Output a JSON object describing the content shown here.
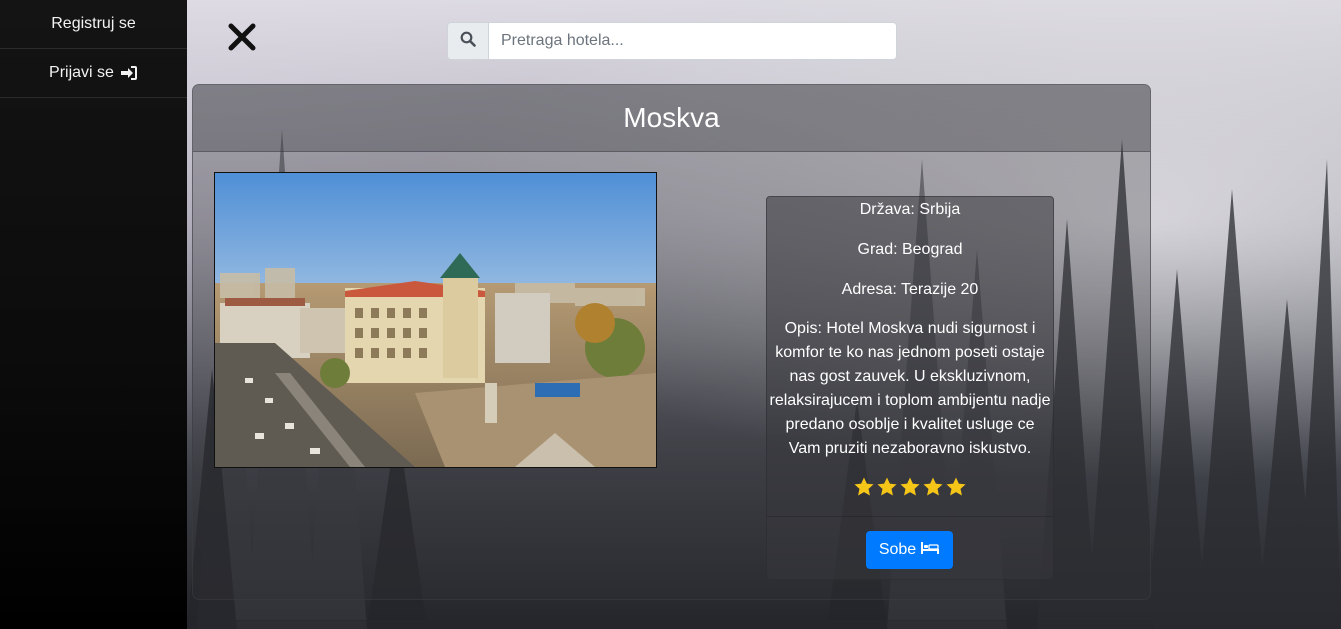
{
  "sidebar": {
    "items": [
      {
        "label": "Registruj se",
        "icon": "none"
      },
      {
        "label": "Prijavi se",
        "icon": "sign-in-icon"
      }
    ]
  },
  "search": {
    "placeholder": "Pretraga hotela...",
    "value": "",
    "icon": "search-icon"
  },
  "hotel": {
    "name": "Moskva",
    "country": "Država: Srbija",
    "city": "Grad: Beograd",
    "address": "Adresa: Terazije 20",
    "description": "Opis: Hotel Moskva nudi sigurnost i komfor te ko nas jednom poseti ostaje nas gost zauvek. U ekskluzivnom, relaksirajucem i toplom ambijentu nadje predano osoblje i kvalitet usluge ce Vam pruziti nezaboravno iskustvo.",
    "rating": 5,
    "rating_max": 5,
    "rooms_button": "Sobe",
    "rooms_icon": "bed-icon"
  },
  "colors": {
    "accent": "#007bff",
    "star": "#f5c518",
    "sidebar_bg": "#0d0d0d"
  }
}
